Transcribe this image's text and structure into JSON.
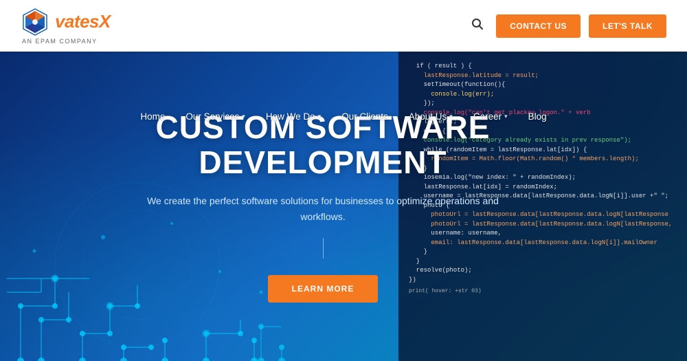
{
  "header": {
    "logo_text": "vates",
    "logo_suffix": "X",
    "logo_subtitle": "AN EPAM COMPANY",
    "btn_contact": "CONTACT US",
    "btn_lets_talk": "LET'S TALK"
  },
  "nav": {
    "items": [
      {
        "label": "Home",
        "has_dropdown": false
      },
      {
        "label": "Our Services",
        "has_dropdown": true
      },
      {
        "label": "How We Do",
        "has_dropdown": true
      },
      {
        "label": "Our Clients",
        "has_dropdown": false
      },
      {
        "label": "About Us",
        "has_dropdown": true
      },
      {
        "label": "Career",
        "has_dropdown": true
      },
      {
        "label": "Blog",
        "has_dropdown": false
      }
    ]
  },
  "hero": {
    "title_line1": "CUSTOM SOFTWARE",
    "title_line2": "DEVELOPMENT",
    "subtitle": "We create the perfect software solutions for businesses to optimize operations and workflows.",
    "btn_learn_more": "LEARN MORE"
  }
}
